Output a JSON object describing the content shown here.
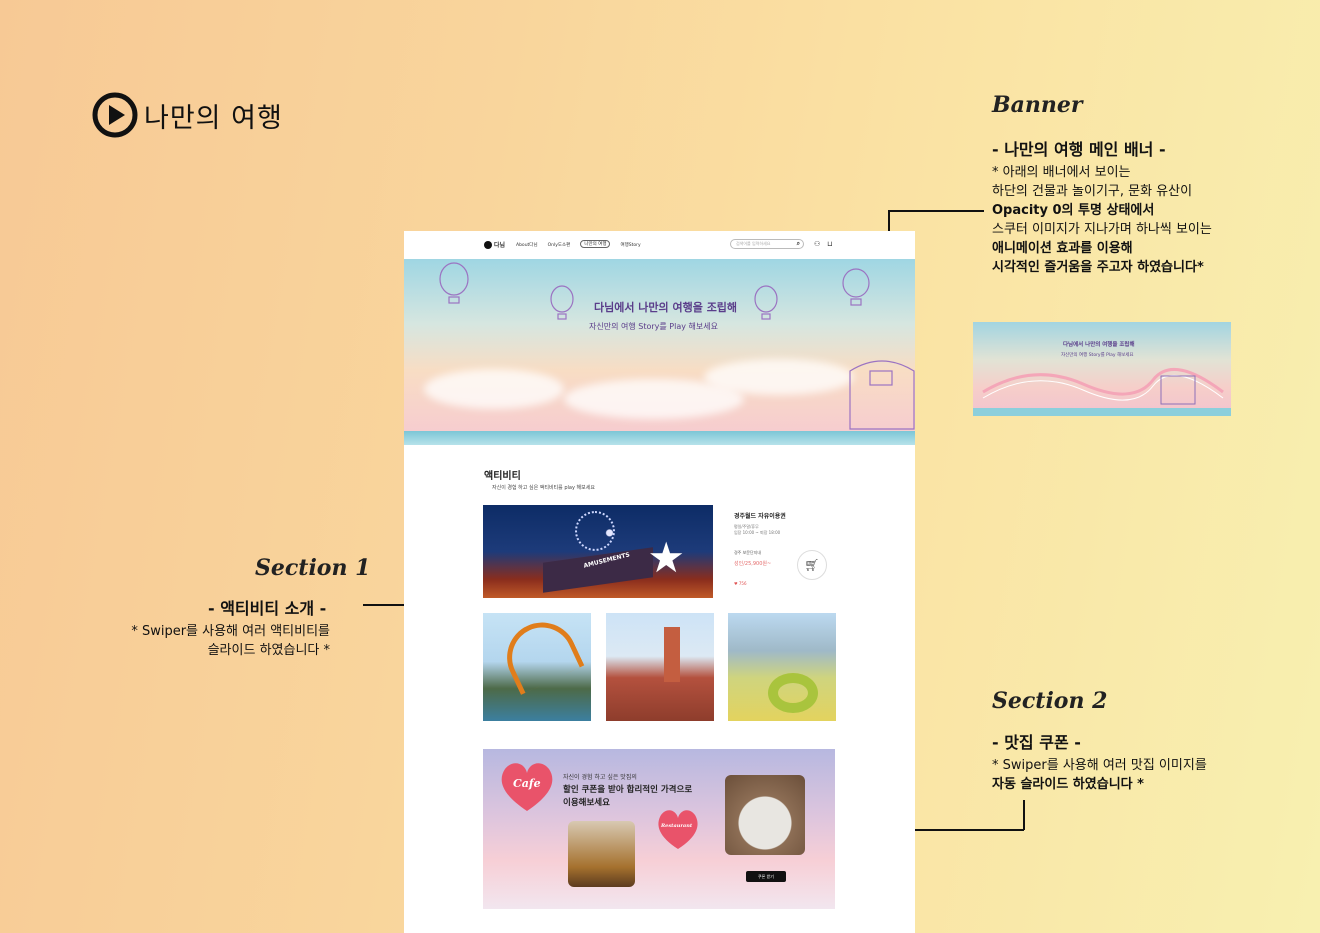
{
  "page": {
    "title": "나만의 여행"
  },
  "annotations": {
    "banner": {
      "script": "Banner",
      "heading": "- 나만의 여행 메인 배너 -",
      "lines": [
        "* 아래의 배너에서 보이는",
        "하단의 건물과 놀이기구, 문화 유산이",
        "Opacity 0의 투명 상태에서",
        "스쿠터 이미지가 지나가며 하나씩 보이는",
        "애니메이션 효과를 이용해",
        "시각적인 즐거움을 주고자 하였습니다*"
      ]
    },
    "section1": {
      "script": "Section 1",
      "heading": "- 액티비티 소개 -",
      "lines": [
        "* Swiper를 사용해 여러 액티비티를",
        "슬라이드 하였습니다 *"
      ]
    },
    "section2": {
      "script": "Section 2",
      "heading": "- 맛집 쿠폰 -",
      "lines": [
        "* Swiper를 사용해 여러 맛집 이미지를",
        "자동 슬라이드 하였습니다 *"
      ]
    }
  },
  "mock": {
    "logo": "다님",
    "menu": [
      "About다님",
      "Only도소편",
      "나만의 여행",
      "여행Story"
    ],
    "search_placeholder": "검색어를 입력하세요",
    "banner": {
      "line1": "다님에서 나만의 여행을 조립해",
      "line2": "자신만의 여행 Story를 Play 해보세요"
    },
    "activity": {
      "title": "액티비티",
      "subtitle": "자신이 경험 하고 싶은 액티비티를 play 해보세요",
      "hero_sign": "AMUSEMENTS",
      "name": "경주월드 자유이용권",
      "meta": [
        "평일/주말/휴무",
        "입장 10:00 ~ 퇴장 18:00"
      ],
      "location": "경주 보문단지내",
      "price": "성인/25,900원~",
      "likes": "♥ 756"
    },
    "coupon": {
      "cafe_label": "Cafe",
      "restaurant_label": "Restaurant",
      "line1": "자신이 경험 하고 싶은 맛집의",
      "line2": "할인 쿠폰을 받아 합리적인 가격으로",
      "line3": "이용해보세요",
      "button": "쿠폰 받기"
    }
  },
  "small_banner": {
    "line1": "다님에서 나만의 여행을 조립해",
    "line2": "자신만의 여행 Story를 Play 해보세요"
  }
}
